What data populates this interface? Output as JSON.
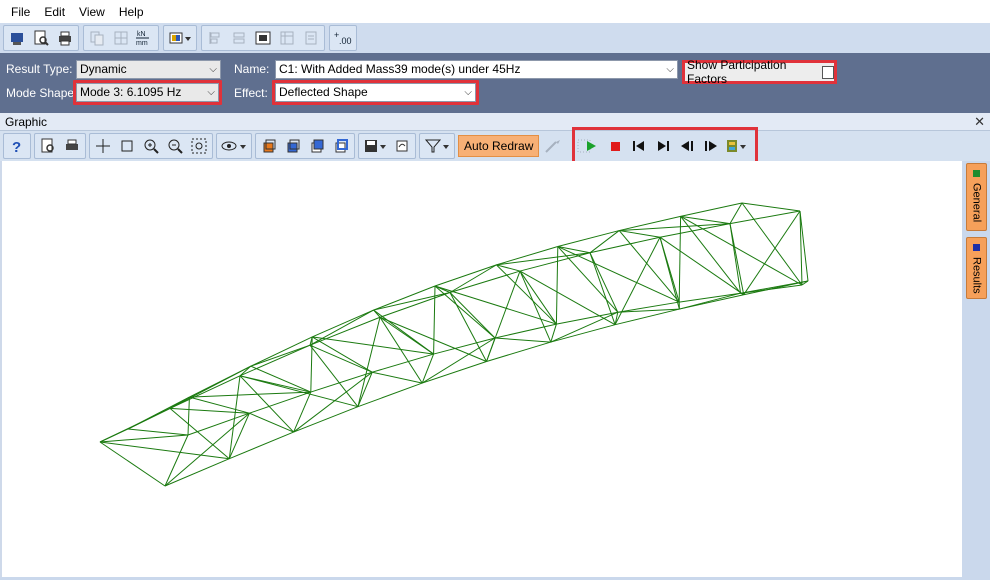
{
  "menu": [
    "File",
    "Edit",
    "View",
    "Help"
  ],
  "main_toolbar": {
    "icons": [
      "model-icon",
      "print-preview-icon",
      "print-icon",
      "copy-icon",
      "grid-icon",
      "units-icon",
      "color-scheme-icon",
      "align-icon",
      "align2-icon",
      "image-icon",
      "table-icon",
      "document-icon",
      "decimal-icon"
    ],
    "units_label": "kN–mm"
  },
  "filter": {
    "result_type_label": "Result Type:",
    "result_type_value": "Dynamic",
    "mode_shape_label": "Mode Shape:",
    "mode_shape_value": "Mode 3: 6.1095 Hz",
    "name_label": "Name:",
    "name_value": "C1: With Added Mass39 mode(s) under 45Hz",
    "effect_label": "Effect:",
    "effect_value": "Deflected Shape",
    "participation_label": "Show Participation Factors",
    "participation_checked": false
  },
  "graphic": {
    "title": "Graphic",
    "auto_redraw_label": "Auto Redraw",
    "right_tabs": [
      {
        "label": "General",
        "color": "#1e8c2e"
      },
      {
        "label": "Results",
        "color": "#1c2fa8"
      }
    ],
    "mesh_color": "#1b7a10"
  }
}
